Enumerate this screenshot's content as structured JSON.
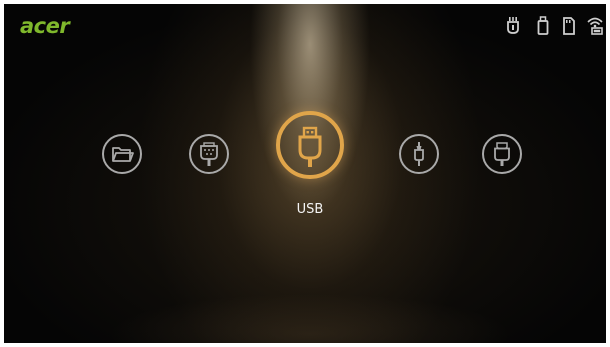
{
  "brand": {
    "logo_text": "acer",
    "logo_color": "#7fb82c"
  },
  "status_bar": {
    "icons": [
      "usb-plug-icon",
      "usb-drive-icon",
      "sd-card-icon",
      "wifi-display-icon"
    ]
  },
  "sources": [
    {
      "icon": "folder-icon",
      "selected": false
    },
    {
      "icon": "vga-connector-icon",
      "selected": false
    },
    {
      "icon": "usb-icon",
      "selected": true
    },
    {
      "icon": "av-jack-icon",
      "selected": false
    },
    {
      "icon": "hdmi-connector-icon",
      "selected": false
    }
  ],
  "selected_source_label": "USB",
  "colors": {
    "background": "#050505",
    "accent": "#e0a54a",
    "icon_default": "#a9a9a9"
  }
}
